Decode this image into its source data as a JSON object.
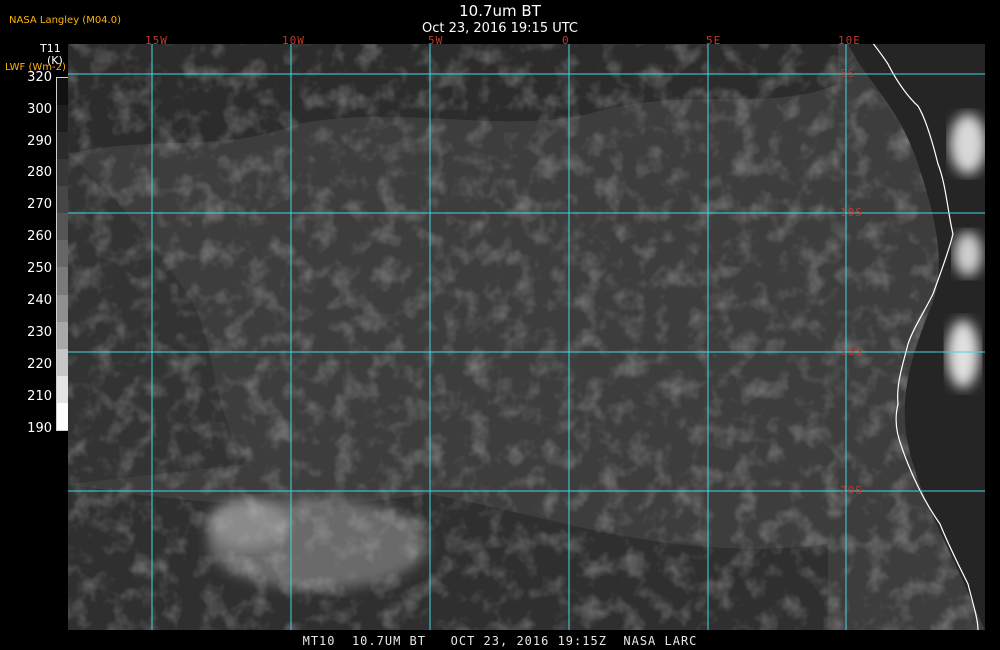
{
  "header": {
    "title": "10.7um BT",
    "subtitle": "Oct 23, 2016 19:15 UTC",
    "agency": "NASA Langley (M04.0)"
  },
  "legend": {
    "variable": "T11",
    "unit": "(K)",
    "secondary": "LWF (Wm-2)",
    "ticks": [
      "320",
      "300",
      "290",
      "280",
      "270",
      "260",
      "250",
      "240",
      "230",
      "220",
      "210",
      "190"
    ],
    "colors": [
      "#111111",
      "#1e1e1e",
      "#2b2b2b",
      "#383838",
      "#464646",
      "#555555",
      "#666666",
      "#7a7a7a",
      "#8f8f8f",
      "#a8a8a8",
      "#c6c6c6",
      "#e4e4e4",
      "#ffffff"
    ]
  },
  "map": {
    "longitudes": [
      "15W",
      "10W",
      "5W",
      "0",
      "5E",
      "10E"
    ],
    "latitudes": [
      "5S",
      "10S",
      "15S",
      "20S"
    ],
    "grid_color": "#3fd8e0",
    "label_color": "#c0392b",
    "coast_color": "#ffffff"
  },
  "footer": {
    "text": "MT10  10.7UM BT   OCT 23, 2016 19:15Z  NASA LARC"
  }
}
